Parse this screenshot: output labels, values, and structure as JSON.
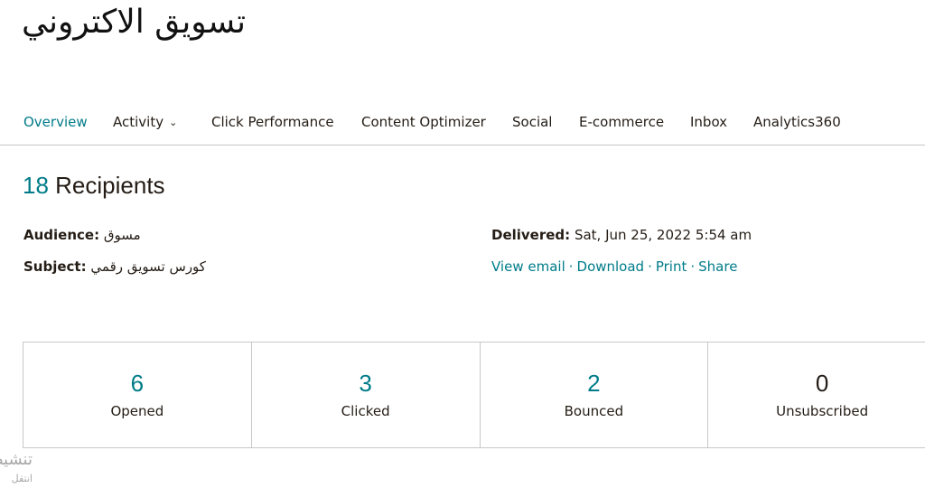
{
  "campaign": {
    "title": "تسويق الاكتروني"
  },
  "tabs": [
    {
      "label": "Overview",
      "active": true
    },
    {
      "label": "Activity",
      "dropdown": true
    },
    {
      "label": "Click Performance"
    },
    {
      "label": "Content Optimizer"
    },
    {
      "label": "Social"
    },
    {
      "label": "E-commerce"
    },
    {
      "label": "Inbox"
    },
    {
      "label": "Analytics360"
    }
  ],
  "recipients": {
    "count": "18",
    "label": "Recipients"
  },
  "details": {
    "audience_label": "Audience:",
    "audience_value": "مسوق",
    "subject_label": "Subject:",
    "subject_value": "كورس تسويق رقمي",
    "delivered_label": "Delivered:",
    "delivered_value": "Sat, Jun 25, 2022 5:54 am"
  },
  "actions": {
    "view_email": "View email",
    "download": "Download",
    "print": "Print",
    "share": "Share",
    "separator": "·"
  },
  "stats": [
    {
      "value": "6",
      "label": "Opened"
    },
    {
      "value": "3",
      "label": "Clicked"
    },
    {
      "value": "2",
      "label": "Bounced"
    },
    {
      "value": "0",
      "label": "Unsubscribed"
    }
  ],
  "watermark": {
    "line1": "تنشيط",
    "line2": "انتقل"
  },
  "colors": {
    "accent": "#007c89",
    "text": "#241c15",
    "border": "#c8c8c8"
  }
}
